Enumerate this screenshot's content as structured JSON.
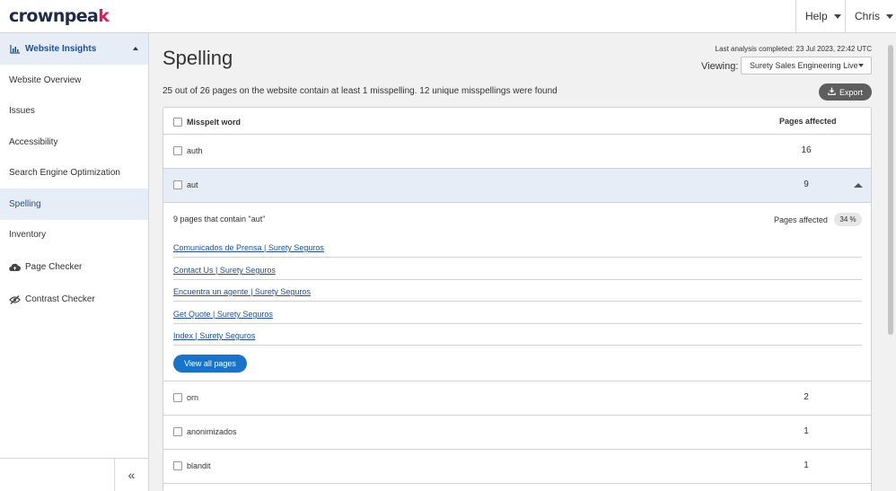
{
  "brand": {
    "logo_main": "crownpea",
    "logo_k": "k"
  },
  "topbar": {
    "help_label": "Help",
    "user_label": "Chris"
  },
  "sidebar": {
    "section_label": "Website Insights",
    "items": [
      {
        "label": "Website Overview"
      },
      {
        "label": "Issues"
      },
      {
        "label": "Accessibility"
      },
      {
        "label": "Search Engine Optimization"
      },
      {
        "label": "Spelling",
        "active": true
      },
      {
        "label": "Inventory"
      }
    ],
    "tools": [
      {
        "label": "Page Checker",
        "icon": "cloud-upload-icon"
      },
      {
        "label": "Contrast Checker",
        "icon": "eye-slash-icon"
      }
    ],
    "collapse_glyph": "«"
  },
  "main": {
    "title": "Spelling",
    "last_analysis": "Last analysis completed: 23 Jul 2023, 22:42 UTC",
    "viewing_label": "Viewing:",
    "viewing_value": "Surety Sales Engineering Live",
    "summary": "25 out of 26 pages on the website contain at least 1 misspelling. 12 unique misspellings were found",
    "export_label": "Export"
  },
  "table": {
    "col_word": "Misspelt word",
    "col_pages": "Pages affected",
    "rows": [
      {
        "word": "auth",
        "count": "16"
      },
      {
        "word": "aut",
        "count": "9",
        "expanded": true
      },
      {
        "word": "orn",
        "count": "2"
      },
      {
        "word": "anonimizados",
        "count": "1"
      },
      {
        "word": "blandit",
        "count": "1"
      }
    ],
    "detail": {
      "heading": "9 pages that contain \"aut\"",
      "pages_affected_label": "Pages affected",
      "percent": "34 %",
      "pages": [
        "Comunicados de Prensa | Surety Seguros",
        "Contact Us | Surety Seguros",
        "Encuentra un agente | Surety Seguros",
        "Get Quote | Surety Seguros",
        "Index | Surety Seguros"
      ],
      "view_all_label": "View all pages"
    }
  },
  "colors": {
    "accent": "#1f4f91",
    "button_blue": "#1a73c9",
    "brand_pink": "#e0195a",
    "brand_navy": "#1e2a4a"
  }
}
